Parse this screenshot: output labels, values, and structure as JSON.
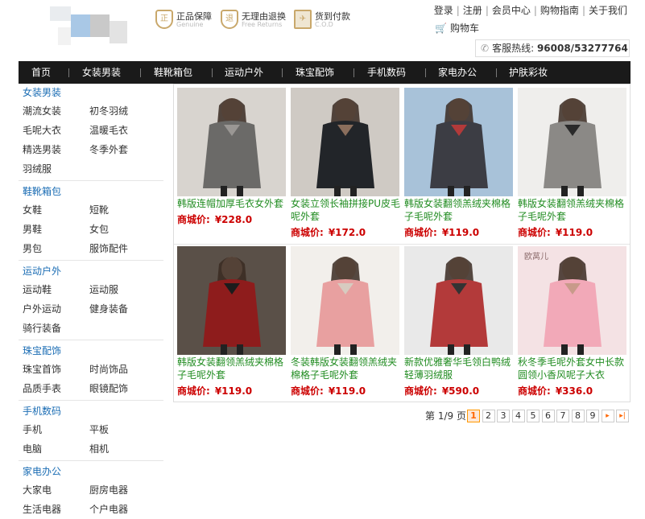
{
  "header": {
    "assurances": [
      {
        "icon": "genuine-shield-icon",
        "glyph": "正",
        "title": "正品保障",
        "sub": "Genuine"
      },
      {
        "icon": "return-shield-icon",
        "glyph": "退",
        "title": "无理由退换",
        "sub": "Free Returns"
      },
      {
        "icon": "cod-plane-icon",
        "glyph": "✈",
        "title": "货到付款",
        "sub": "C.O.D"
      }
    ],
    "links": [
      "登录",
      "注册",
      "会员中心",
      "购物指南",
      "关于我们"
    ],
    "cart_label": "购物车",
    "hotline_label": "客服热线:",
    "hotline_number": "96008/53277764"
  },
  "nav": {
    "items": [
      "首页",
      "女装男装",
      "鞋靴箱包",
      "运动户外",
      "珠宝配饰",
      "手机数码",
      "家电办公",
      "护肤彩妆"
    ]
  },
  "sidebar": {
    "categories": [
      {
        "title": "女装男装",
        "rows": [
          [
            "潮流女装",
            "初冬羽绒"
          ],
          [
            "毛呢大衣",
            "温暖毛衣"
          ],
          [
            "精选男装",
            "冬季外套"
          ],
          [
            "羽绒服",
            ""
          ]
        ]
      },
      {
        "title": "鞋靴箱包",
        "rows": [
          [
            "女鞋",
            "短靴"
          ],
          [
            "男鞋",
            "女包"
          ],
          [
            "男包",
            "服饰配件"
          ]
        ]
      },
      {
        "title": "运动户外",
        "rows": [
          [
            "运动鞋",
            "运动服"
          ],
          [
            "户外运动",
            "健身装备"
          ],
          [
            "骑行装备",
            ""
          ]
        ]
      },
      {
        "title": "珠宝配饰",
        "rows": [
          [
            "珠宝首饰",
            "时尚饰品"
          ],
          [
            "品质手表",
            "眼镜配饰"
          ]
        ]
      },
      {
        "title": "手机数码",
        "rows": [
          [
            "手机",
            "平板"
          ],
          [
            "电脑",
            "相机"
          ]
        ]
      },
      {
        "title": "家电办公",
        "rows": [
          [
            "大家电",
            "厨房电器"
          ],
          [
            "生活电器",
            "个户电器"
          ]
        ]
      }
    ]
  },
  "products": [
    {
      "name": "韩版连帽加厚毛衣女外套",
      "price_label": "商城价:",
      "price": "¥228.0",
      "colors": [
        "#d8d4cf",
        "#6b6a68",
        "#9a9794"
      ],
      "overlay": ""
    },
    {
      "name": "女装立领长袖拼接PU皮毛呢外套",
      "price_label": "商城价:",
      "price": "¥172.0",
      "colors": [
        "#cfcac4",
        "#222529",
        "#8a6e5c"
      ],
      "overlay": ""
    },
    {
      "name": "韩版女装翻领羔绒夹棉格子毛呢外套",
      "price_label": "商城价:",
      "price": "¥119.0",
      "colors": [
        "#a8c2d9",
        "#3c3d44",
        "#b23a3a"
      ],
      "overlay": ""
    },
    {
      "name": "韩版女装翻领羔绒夹棉格子毛呢外套",
      "price_label": "商城价:",
      "price": "¥119.0",
      "colors": [
        "#efeeec",
        "#8b8986",
        "#2a2a2a"
      ],
      "overlay": ""
    },
    {
      "name": "韩版女装翻领羔绒夹棉格子毛呢外套",
      "price_label": "商城价:",
      "price": "¥119.0",
      "colors": [
        "#5a5048",
        "#8e1c1c",
        "#1c1c1c"
      ],
      "overlay": ""
    },
    {
      "name": "冬装韩版女装翻领羔绒夹棉格子毛呢外套",
      "price_label": "商城价:",
      "price": "¥119.0",
      "colors": [
        "#f2efeb",
        "#e8a0a0",
        "#d7cbc0"
      ],
      "overlay": ""
    },
    {
      "name": "新款优雅奢华毛领白鸭绒轻薄羽绒服",
      "price_label": "商城价:",
      "price": "¥590.0",
      "colors": [
        "#e9e9e9",
        "#b33a3a",
        "#333333"
      ],
      "overlay": ""
    },
    {
      "name": "秋冬季毛呢外套女中长款圆领小香风呢子大衣",
      "price_label": "商城价:",
      "price": "¥336.0",
      "colors": [
        "#f4e2e4",
        "#f2a9b8",
        "#c89a8a"
      ],
      "overlay": "欧莴儿"
    }
  ],
  "pager": {
    "label": "第 1/9 页",
    "pages": [
      "1",
      "2",
      "3",
      "4",
      "5",
      "6",
      "7",
      "8",
      "9"
    ],
    "next": "▸",
    "last": "▸|"
  }
}
